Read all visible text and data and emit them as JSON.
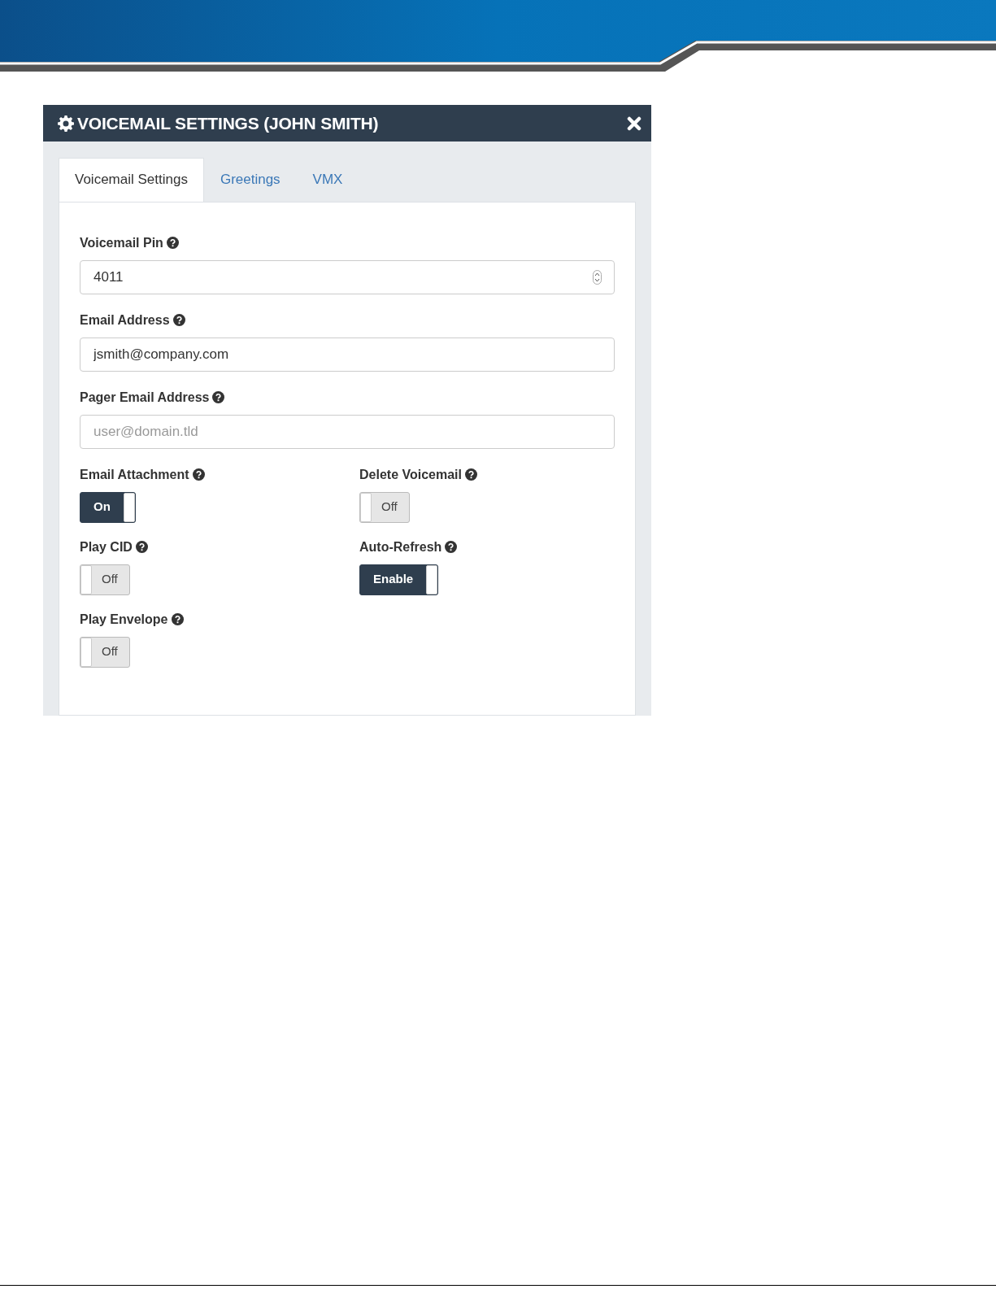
{
  "dialog": {
    "title": "VOICEMAIL SETTINGS (JOHN SMITH)"
  },
  "tabs": [
    {
      "label": "Voicemail Settings",
      "selected": true
    },
    {
      "label": "Greetings",
      "selected": false
    },
    {
      "label": "VMX",
      "selected": false
    }
  ],
  "fields": [
    {
      "label": "Voicemail Pin",
      "kind": "number",
      "value": "4011"
    },
    {
      "label": "Email Address",
      "kind": "text",
      "value": "jsmith@company.com"
    },
    {
      "label": "Pager Email Address",
      "kind": "text",
      "placeholder": "user@domain.tld"
    }
  ],
  "toggles": [
    {
      "label": "Email Attachment",
      "on": true,
      "text": "On"
    },
    {
      "label": "Delete Voicemail",
      "on": false,
      "text": "Off"
    },
    {
      "label": "Play CID",
      "on": false,
      "text": "Off"
    },
    {
      "label": "Auto-Refresh",
      "on": true,
      "text": "Enable"
    },
    {
      "label": "Play Envelope",
      "on": false,
      "text": "Off"
    }
  ]
}
